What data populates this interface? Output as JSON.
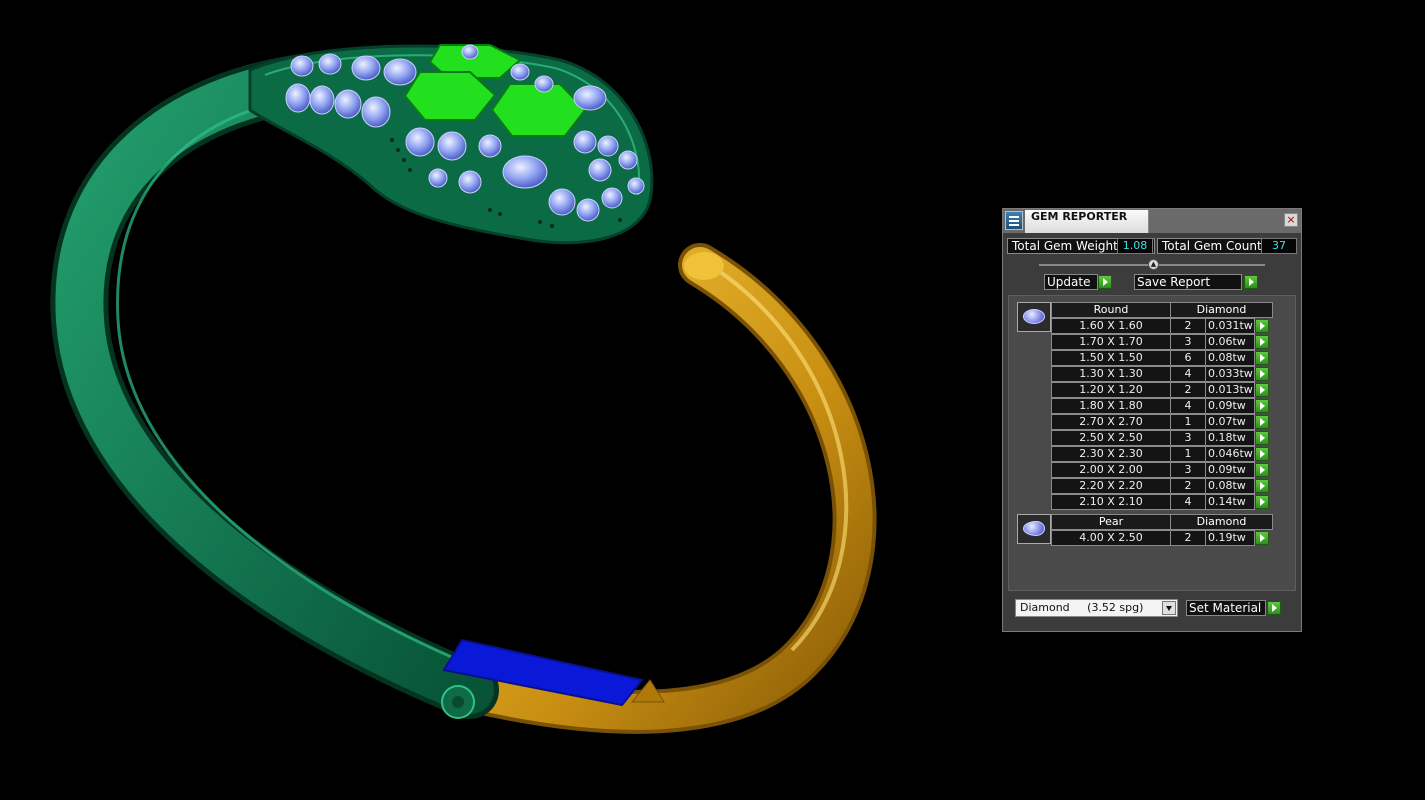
{
  "panel": {
    "title": "GEM REPORTER",
    "close_glyph": "×",
    "total_weight_label": "Total Gem Weight",
    "total_weight_value": "1.08",
    "total_count_label": "Total Gem Count",
    "total_count_value": "37",
    "update_label": "Update",
    "save_report_label": "Save Report",
    "set_material_label": "Set Material",
    "material_selected": "Diamond     (3.52 spg)"
  },
  "groups": [
    {
      "shape": "Round",
      "material": "Diamond",
      "icon": "round-gem-icon",
      "rows": [
        {
          "size": "1.60 X 1.60",
          "count": "2",
          "weight": "0.031tw"
        },
        {
          "size": "1.70 X 1.70",
          "count": "3",
          "weight": "0.06tw"
        },
        {
          "size": "1.50 X 1.50",
          "count": "6",
          "weight": "0.08tw"
        },
        {
          "size": "1.30 X 1.30",
          "count": "4",
          "weight": "0.033tw"
        },
        {
          "size": "1.20 X 1.20",
          "count": "2",
          "weight": "0.013tw"
        },
        {
          "size": "1.80 X 1.80",
          "count": "4",
          "weight": "0.09tw"
        },
        {
          "size": "2.70 X 2.70",
          "count": "1",
          "weight": "0.07tw"
        },
        {
          "size": "2.50 X 2.50",
          "count": "3",
          "weight": "0.18tw"
        },
        {
          "size": "2.30 X 2.30",
          "count": "1",
          "weight": "0.046tw"
        },
        {
          "size": "2.00 X 2.00",
          "count": "3",
          "weight": "0.09tw"
        },
        {
          "size": "2.20 X 2.20",
          "count": "2",
          "weight": "0.08tw"
        },
        {
          "size": "2.10 X 2.10",
          "count": "4",
          "weight": "0.14tw"
        }
      ]
    },
    {
      "shape": "Pear",
      "material": "Diamond",
      "icon": "pear-gem-icon",
      "rows": [
        {
          "size": "4.00 X 2.50",
          "count": "2",
          "weight": "0.19tw"
        }
      ]
    }
  ],
  "colors": {
    "green_body": "#0f7a52",
    "gold_body": "#d9a21b",
    "emerald_scale": "#22e01e",
    "blue_inlay": "#0a18d8",
    "gem_blue": "#8ea2f2",
    "value_cyan": "#3ee0e8"
  }
}
